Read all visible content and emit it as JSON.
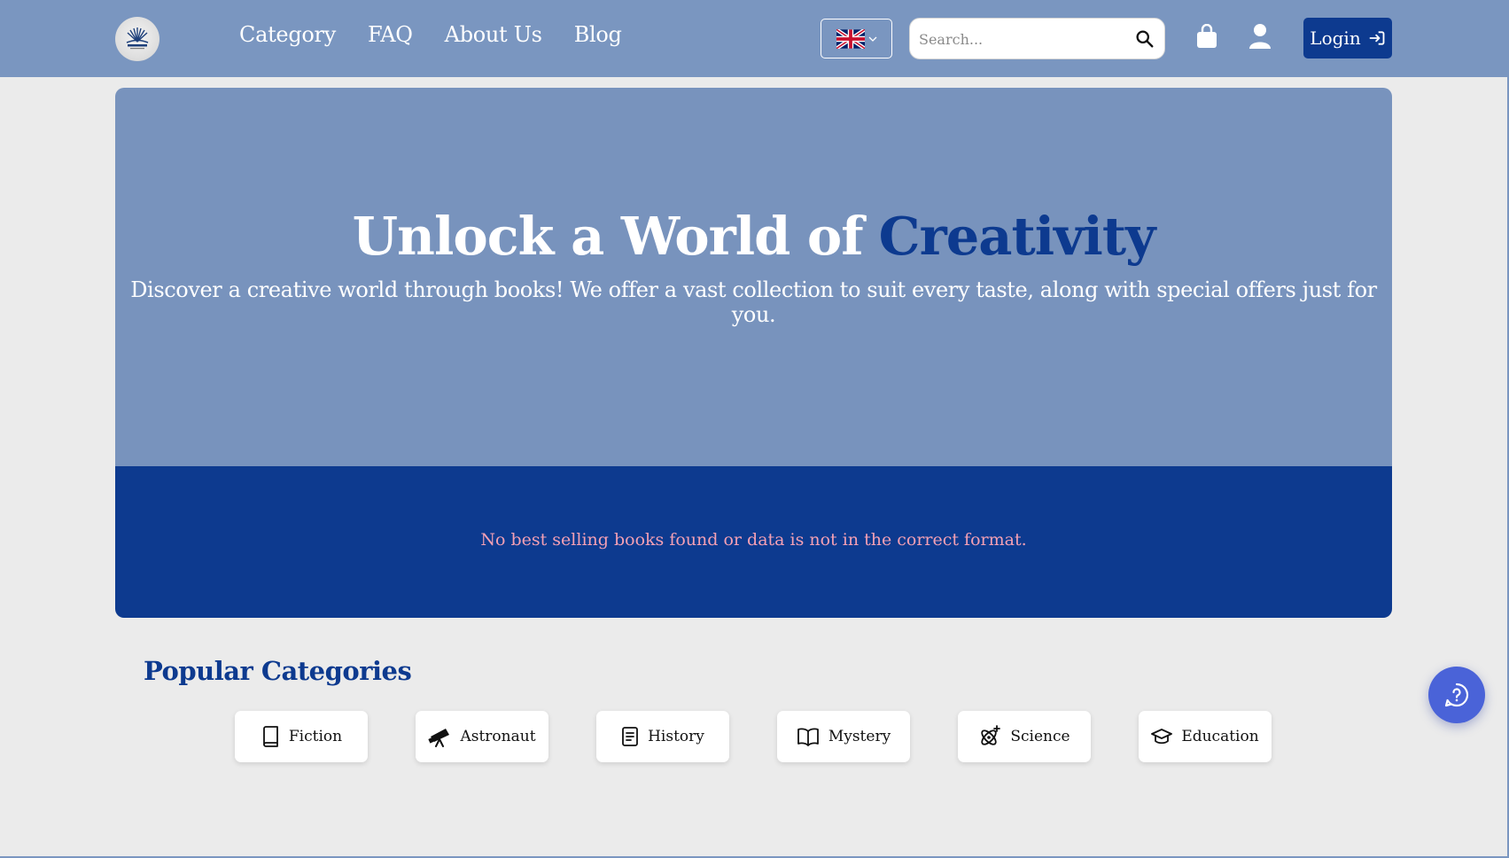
{
  "header": {
    "nav": [
      {
        "label": "Category"
      },
      {
        "label": "FAQ"
      },
      {
        "label": "About Us"
      },
      {
        "label": "Blog"
      }
    ],
    "language": "uk-flag",
    "search": {
      "placeholder": "Search...",
      "value": ""
    },
    "login_label": "Login"
  },
  "hero": {
    "title_main": "Unlock a World of",
    "title_accent": "Creativity",
    "subtitle": "Discover a creative world through books! We offer a vast collection to suit every taste, along with special offers just for you.",
    "empty_message": "No best selling books found or data is not in the correct format."
  },
  "categories": {
    "title": "Popular Categories",
    "items": [
      {
        "label": "Fiction",
        "icon": "book-icon"
      },
      {
        "label": "Astronaut",
        "icon": "telescope-icon"
      },
      {
        "label": "History",
        "icon": "document-icon"
      },
      {
        "label": "Mystery",
        "icon": "open-book-icon"
      },
      {
        "label": "Science",
        "icon": "atom-icon"
      },
      {
        "label": "Education",
        "icon": "graduation-cap-icon"
      }
    ]
  },
  "colors": {
    "header_bg": "#7a96c0",
    "brand_dark": "#0d3a8f",
    "hero_light": "#7893bd",
    "error_text": "#f4a0b4",
    "fab": "#4a63d8"
  }
}
